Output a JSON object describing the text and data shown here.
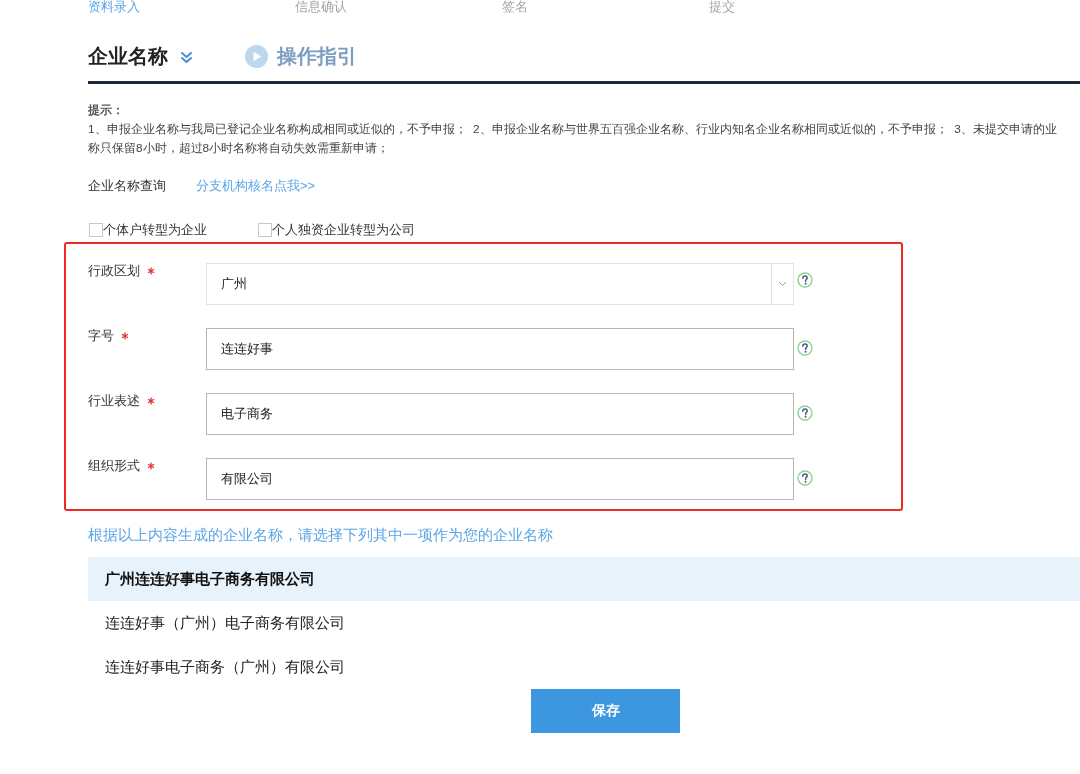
{
  "steps": [
    {
      "label": "资料录入",
      "selected": true
    },
    {
      "label": "信息确认",
      "selected": false
    },
    {
      "label": "签名",
      "selected": false
    },
    {
      "label": "提交",
      "selected": false
    }
  ],
  "header": {
    "title": "企业名称",
    "guide_link": "操作指引"
  },
  "notice": {
    "title": "提示：",
    "lines": [
      "1、申报企业名称与我局已登记企业名称构成相同或近似的，不予申报；  2、申报企业名称与世界五百强企业名称、行业内知名企业名称相同或近似的，不予申报；  3、未提交申请的业",
      "称只保留8小时，超过8小时名称将自动失效需重新申请；"
    ]
  },
  "name_query": {
    "label": "企业名称查询",
    "link": "分支机构核名点我>>"
  },
  "conversions": [
    {
      "label": "个体户转型为企业",
      "checked": false
    },
    {
      "label": "个人独资企业转型为公司",
      "checked": false
    }
  ],
  "form": {
    "fields": [
      {
        "label": "行政区划",
        "required": true,
        "kind": "select",
        "value": "广州"
      },
      {
        "label": "字号",
        "required": true,
        "kind": "text",
        "value": "连连好事"
      },
      {
        "label": "行业表述",
        "required": true,
        "kind": "text",
        "value": "电子商务"
      },
      {
        "label": "组织形式",
        "required": true,
        "kind": "text",
        "value": "有限公司"
      }
    ]
  },
  "suggestions": {
    "prompt": "根据以上内容生成的企业名称，请选择下列其中一项作为您的企业名称",
    "options": [
      {
        "name": "广州连连好事电子商务有限公司",
        "selected": true
      },
      {
        "name": "连连好事（广州）电子商务有限公司",
        "selected": false
      },
      {
        "name": "连连好事电子商务（广州）有限公司",
        "selected": false
      }
    ]
  },
  "save_button": "保存"
}
